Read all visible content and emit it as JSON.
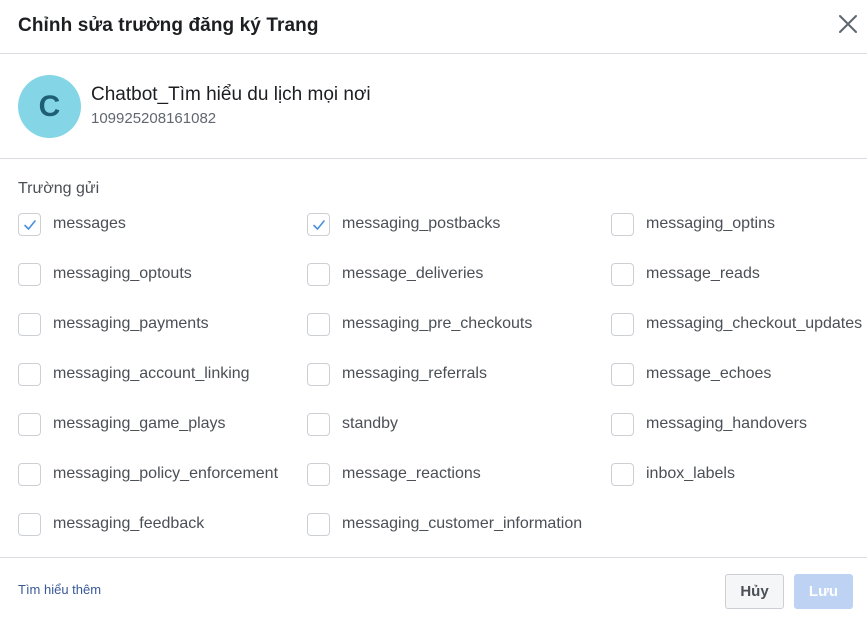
{
  "dialog": {
    "title": "Chỉnh sửa trường đăng ký Trang"
  },
  "page": {
    "avatar_letter": "C",
    "name": "Chatbot_Tìm hiểu du lịch mọi nơi",
    "id": "109925208161082"
  },
  "fields_section": {
    "label": "Trường gửi",
    "fields": [
      {
        "label": "messages",
        "checked": true
      },
      {
        "label": "messaging_postbacks",
        "checked": true
      },
      {
        "label": "messaging_optins",
        "checked": false
      },
      {
        "label": "messaging_optouts",
        "checked": false
      },
      {
        "label": "message_deliveries",
        "checked": false
      },
      {
        "label": "message_reads",
        "checked": false
      },
      {
        "label": "messaging_payments",
        "checked": false
      },
      {
        "label": "messaging_pre_checkouts",
        "checked": false
      },
      {
        "label": "messaging_checkout_updates",
        "checked": false
      },
      {
        "label": "messaging_account_linking",
        "checked": false
      },
      {
        "label": "messaging_referrals",
        "checked": false
      },
      {
        "label": "message_echoes",
        "checked": false
      },
      {
        "label": "messaging_game_plays",
        "checked": false
      },
      {
        "label": "standby",
        "checked": false
      },
      {
        "label": "messaging_handovers",
        "checked": false
      },
      {
        "label": "messaging_policy_enforcement",
        "checked": false
      },
      {
        "label": "message_reactions",
        "checked": false
      },
      {
        "label": "inbox_labels",
        "checked": false
      },
      {
        "label": "messaging_feedback",
        "checked": false
      },
      {
        "label": "messaging_customer_information",
        "checked": false
      }
    ]
  },
  "footer": {
    "learn_more": "Tìm hiểu thêm",
    "cancel_label": "Hủy",
    "save_label": "Lưu"
  },
  "colors": {
    "avatar_bg": "#84d6e6",
    "check_mark": "#4a90d9",
    "link": "#385898",
    "save_disabled": "#bed2f4"
  }
}
